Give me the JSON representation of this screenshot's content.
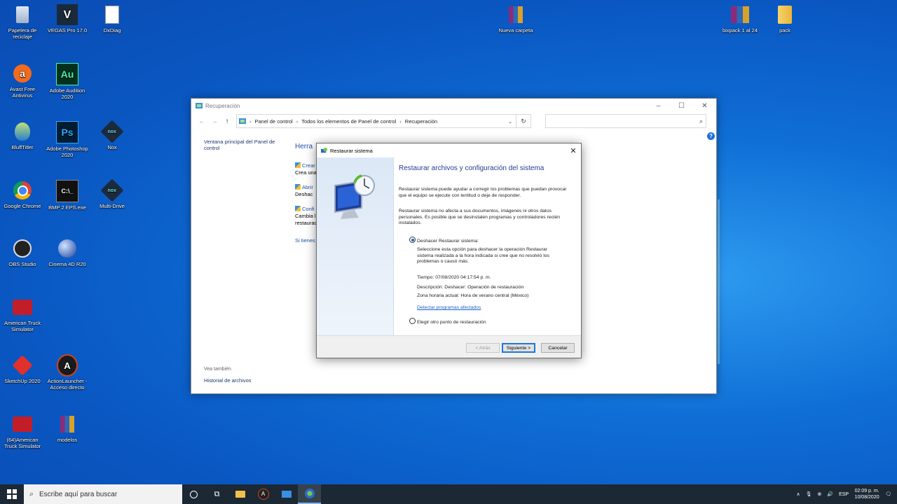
{
  "desktop": {
    "icons": [
      {
        "label": "Papelera de reciclaje"
      },
      {
        "label": "VEGAS Pro 17.0",
        "glyph": "V"
      },
      {
        "label": "DxDiag"
      },
      {
        "label": "Nueva carpeta"
      },
      {
        "label": "bixpack 1 al 24"
      },
      {
        "label": "pack"
      },
      {
        "label": "Avast Free Antivirus"
      },
      {
        "label": "Adobe Audition 2020",
        "glyph": "Au"
      },
      {
        "label": "BluffTitler"
      },
      {
        "label": "Adobe Photoshop 2020",
        "glyph": "Ps"
      },
      {
        "label": "Nox",
        "glyph": "nox"
      },
      {
        "label": "Google Chrome"
      },
      {
        "label": "BMP 2 EPS.exe",
        "glyph": "C:\\_"
      },
      {
        "label": "Multi-Drive",
        "glyph": "nox"
      },
      {
        "label": "OBS Studio"
      },
      {
        "label": "Cinema 4D R20"
      },
      {
        "label": "American Truck Simulator"
      },
      {
        "label": "SketchUp 2020"
      },
      {
        "label": "ActionLauncher - Acceso directo",
        "glyph": "A"
      },
      {
        "label": "(64)American Truck Simulator"
      },
      {
        "label": "modelos"
      }
    ]
  },
  "explorer": {
    "title": "Recuperación",
    "address": [
      "Panel de control",
      "Todos los elementos de Panel de control",
      "Recuperación"
    ],
    "left_link": "Ventana principal del Panel de control",
    "see_also_label": "Vea también",
    "see_also_link": "Historial de archivos",
    "heading": "Herra",
    "items": [
      {
        "link": "Crear",
        "text": "Crea una"
      },
      {
        "link": "Abrir",
        "text": "Deshac"
      },
      {
        "link": "Confi",
        "text1": "Cambia l",
        "text2": "restaurac"
      }
    ],
    "bottom_link": "Si tienes"
  },
  "dialog": {
    "title": "Restaurar sistema",
    "heading": "Restaurar archivos y configuración del sistema",
    "para1": "Restaurar sistema puede ayudar a corregir los problemas que puedan provocar que el equipo se ejecute con lentitud o deje de responder.",
    "para2": "Restaurar sistema no afecta a sus documentos, imágenes ni otros datos personales. Es posible que se desinstalen programas y controladores recién instalados.",
    "option1_label": "Deshacer Restaurar sistema:",
    "option1_desc": "Seleccione esta opción para deshacer la operación Restaurar sistema realizada a la hora indicada si cree que no resolvió los problemas o causó más.",
    "time": "Tiempo: 07/08/2020 04:17:54 p. m.",
    "description": "Descripción: Deshacer: Operación de restauración",
    "timezone": "Zona horaria actual: Hora de verano central (México)",
    "detect_link": "Detectar programas afectados",
    "option2_label": "Elegir otro punto de restauración",
    "back_button": "< Atrás",
    "next_button": "Siguiente >",
    "cancel_button": "Cancelar"
  },
  "taskbar": {
    "search_placeholder": "Escribe aquí para buscar",
    "language": "ESP",
    "time": "02:09 p. m.",
    "date": "10/08/2020"
  }
}
